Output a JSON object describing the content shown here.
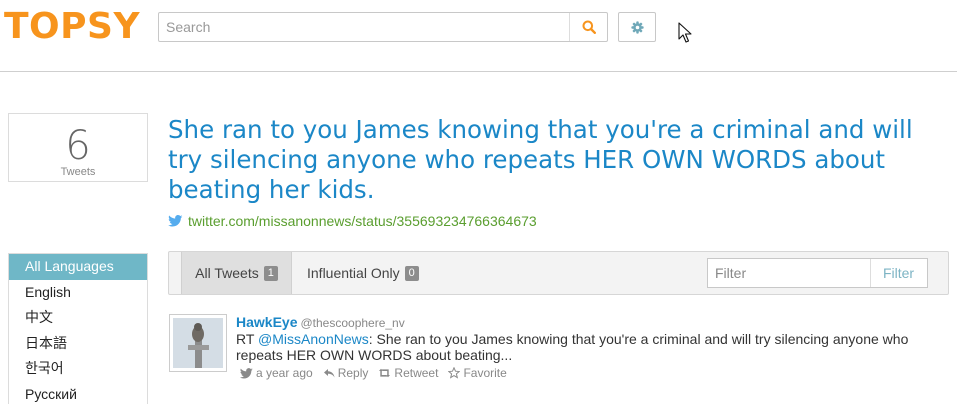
{
  "header": {
    "logo": "TOPSY",
    "search_placeholder": "Search",
    "icons": {
      "search": "search-icon",
      "settings": "gear-icon"
    },
    "colors": {
      "logo": "#f7941d",
      "accent": "#1b87c7",
      "active_lang": "#6fb7c7"
    }
  },
  "summary": {
    "count": "6",
    "count_label": "Tweets"
  },
  "main": {
    "title": "She ran to you James knowing that you're a criminal and will try silencing anyone who repeats HER OWN WORDS about beating her kids.",
    "link": "twitter.com/missanonnews/status/355693234766364673"
  },
  "languages": {
    "items": [
      "All Languages",
      "English",
      "中文",
      "日本語",
      "한국어",
      "Русский"
    ],
    "active": "All Languages"
  },
  "tabs": {
    "all_label": "All Tweets",
    "all_count": "1",
    "influential_label": "Influential Only",
    "influential_count": "0",
    "filter_placeholder": "Filter",
    "filter_button": "Filter"
  },
  "tweet": {
    "name": "HawkEye",
    "handle": "@thescoophere_nv",
    "prefix": "RT ",
    "mention": "@MissAnonNews",
    "text": ": She ran to you James knowing that you're a criminal and will try silencing anyone who repeats HER OWN WORDS about beating...",
    "time": "a year ago",
    "reply": "Reply",
    "retweet": "Retweet",
    "favorite": "Favorite"
  }
}
